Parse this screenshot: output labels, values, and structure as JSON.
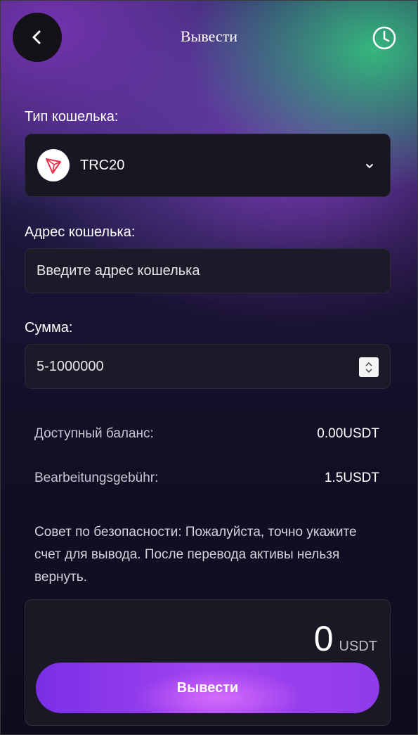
{
  "header": {
    "title": "Вывести",
    "back_icon": "chevron-left-icon",
    "history_icon": "clock-icon"
  },
  "wallet_type": {
    "label": "Тип кошелька:",
    "selected": "TRC20",
    "icon": "tron-logo-icon",
    "dropdown_icon": "chevron-down-icon"
  },
  "wallet_address": {
    "label": "Адрес кошелька:",
    "value": "",
    "placeholder": "Введите адрес кошелька"
  },
  "amount": {
    "label": "Сумма:",
    "value": "",
    "placeholder": "5-1000000"
  },
  "info": {
    "balance_label": "Доступный баланс:",
    "balance_value": "0.00USDT",
    "fee_label": "Bearbeitungsgebühr:",
    "fee_value": "1.5USDT"
  },
  "security_tip": "Совет по безопасности: Пожалуйста, точно укажите счет для вывода. После перевода активы нельзя вернуть.",
  "summary": {
    "amount": "0",
    "currency": "USDT",
    "submit_label": "Вывести"
  },
  "colors": {
    "accent": "#8f3bea",
    "tron_red": "#e8304a",
    "panel": "#1c1a28"
  }
}
